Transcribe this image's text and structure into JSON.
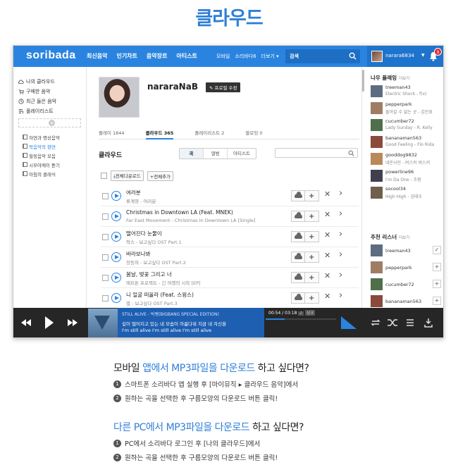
{
  "page_title": "클라우드",
  "app": {
    "logo": "soribada",
    "nav_main": [
      "최신음악",
      "인기차트",
      "음악장르",
      "아티스트"
    ],
    "nav_sub": [
      "모바일",
      "소리바다6",
      "더보기 ▾"
    ],
    "search": {
      "value": "검색"
    },
    "user": {
      "name": "narara6834",
      "notification_count": "9"
    }
  },
  "sidebar": {
    "items": [
      {
        "label": "나의 클라우드"
      },
      {
        "label": "구매한 음악"
      },
      {
        "label": "최근 들은 음악"
      },
      {
        "label": "플레이리스트"
      }
    ],
    "playlists": [
      {
        "label": "자연과 명상음악"
      },
      {
        "label": "락음악의 향연",
        "active": true
      },
      {
        "label": "힐링음악 모음"
      },
      {
        "label": "시부야케이 듣기"
      },
      {
        "label": "아침의 클래식"
      }
    ]
  },
  "profile": {
    "name": "nararaNaB",
    "edit_label": "프로필 수정",
    "tabs": [
      {
        "label": "플레이 1844"
      },
      {
        "label": "클라우드 365",
        "active": true
      },
      {
        "label": "플레이리스트 2"
      },
      {
        "label": "팔로잉 0"
      }
    ]
  },
  "cloud": {
    "title": "클라우드",
    "filters": [
      "곡",
      "앨범",
      "아티스트"
    ],
    "actions": {
      "download_all": "전체다운로드",
      "add_all": "전체추가"
    },
    "songs": [
      {
        "title": "여러분",
        "artist": "류계영 - 여러분"
      },
      {
        "title": "Christmas in Downtown LA (Feat. MNEK)",
        "artist": "Far East Movement - Christmas In Downtown LA [Single]"
      },
      {
        "title": "떨어진다 눈물이",
        "artist": "락스 - 보고싶다 OST Part.1"
      },
      {
        "title": "바라보나봐",
        "artist": "장동하 - 보고싶다 OST Part.2"
      },
      {
        "title": "봄날, 벚꽃 그리고 너",
        "artist": "에피톤 프로젝트 - 긴 여행의 시작 [EP]"
      },
      {
        "title": "니 얼굴 떠올라 (Feat. 스윙스)",
        "artist": "별 - 보고싶다 OST Part.3"
      }
    ]
  },
  "right_panel": {
    "friends_title": "나우 플레잉",
    "friends_more": "더보기",
    "friends": [
      {
        "name": "treeman43",
        "song": "Electric Shock - f(x)",
        "color": "#5d6c80"
      },
      {
        "name": "pepperpark",
        "song": "돌아갈 수 없는 곳 - 김진표",
        "color": "#a07c64"
      },
      {
        "name": "cucumber72",
        "song": "Lady Sunday - R. Kelly",
        "color": "#4f6f4a"
      },
      {
        "name": "bananaman563",
        "song": "Good Feeling - Flo Rida",
        "color": "#8a4a3c"
      },
      {
        "name": "gooddog9832",
        "song": "네온사인 - 버스커 버스커",
        "color": "#b88a5a"
      },
      {
        "name": "powerline96",
        "song": "I'm Da One - 조원",
        "color": "#3f3f4f"
      },
      {
        "name": "socool34",
        "song": "High High - 김태우",
        "color": "#70604a"
      }
    ],
    "recommend_title": "추천 리스너",
    "recommend_more": "더보기",
    "recommend": [
      {
        "name": "treeman43",
        "button": "✓",
        "color": "#5d6c80"
      },
      {
        "name": "pepperpark",
        "button": "+",
        "color": "#a07c64"
      },
      {
        "name": "cucumber72",
        "button": "+",
        "color": "#4f6f4a"
      },
      {
        "name": "bananaman563",
        "button": "+",
        "color": "#8a4a3c"
      }
    ]
  },
  "player": {
    "now_playing": "STILL ALIVE - 빅뱅(BIGBANG SPECIAL EDITION)",
    "lyric_line1": "깊이 떨어지고 있는 내 모습이 아름다워 지금 내 자신을",
    "lyric_line2": "I'm still alive I'm still alive I'm still alive",
    "time": "00:54 / 03:18",
    "time_btn1": "♪",
    "time_btn2": "싱크",
    "progress": 0.27
  },
  "howto_mobile": {
    "heading_pre": "모바일 ",
    "heading_hl": "앱에서 MP3파일을 다운로드",
    "heading_post": " 하고 싶다면?",
    "steps": [
      "스마트폰 소리바다 앱 실행 후 [마이뮤직 ▸ 클라우드 음악]에서",
      "원하는 곡을 선택한 후 구름모양의 다운로드 버튼 클릭!"
    ]
  },
  "howto_pc": {
    "heading_hl": "다른 PC에서 MP3파일을 다운로드",
    "heading_post": " 하고 싶다면?",
    "steps": [
      "PC에서 소리바다 로그인 후 [나의 클라우드]에서",
      "원하는 곡을 선택한 후 구름모양의 다운로드 버튼 클릭!"
    ]
  },
  "colors": {
    "accent": "#2a84df",
    "heading": "#2f7fd8",
    "player_bg": "#262626"
  }
}
